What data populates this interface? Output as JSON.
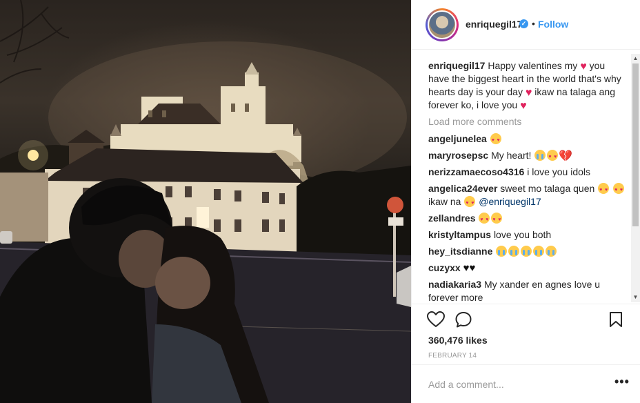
{
  "post": {
    "photo_alt": "Couple embracing at night in front of an illuminated castle",
    "author": {
      "username": "enriquegil17",
      "verified_icon": "verified-badge-icon",
      "separator": "•",
      "follow_label": "Follow"
    },
    "caption": {
      "username": "enriquegil17",
      "part1": "Happy valentines my",
      "part2": "you have the biggest heart in the world that's why hearts day is your day",
      "part3": "ikaw na talaga ang forever ko, i love you"
    },
    "load_more_label": "Load more comments",
    "comments": [
      {
        "user": "angeljunelea",
        "text": "",
        "emoji": [
          "heart-eyes"
        ]
      },
      {
        "user": "maryrosepsc",
        "text": "My heart!",
        "emoji": [
          "cry",
          "heart-eyes",
          "broken-heart"
        ]
      },
      {
        "user": "nerizzamaecoso4316",
        "text": "i love you idols",
        "emoji": []
      },
      {
        "user": "angelica24ever",
        "text": "sweet mo talaga quen",
        "text2": "ikaw na",
        "mention": "@enriquegil17"
      },
      {
        "user": "zellandres",
        "text": "",
        "emoji": [
          "heart-eyes",
          "heart-eyes"
        ]
      },
      {
        "user": "kristyltampus",
        "text": "love you both",
        "emoji": []
      },
      {
        "user": "hey_itsdianne",
        "text": "",
        "emoji": [
          "cry",
          "cry",
          "cry",
          "cry",
          "cry"
        ]
      },
      {
        "user": "cuzyxx",
        "text": "",
        "emoji": [
          "black-heart",
          "black-heart"
        ]
      },
      {
        "user": "nadiakaria3",
        "text": "My xander en agnes love u forever more",
        "emoji": []
      }
    ],
    "likes": "360,476 likes",
    "date": "FEBRUARY 14",
    "add_comment_placeholder": "Add a comment...",
    "more_label": "•••"
  },
  "colors": {
    "link_blue": "#3897f0",
    "heart_red": "#e0245e",
    "muted": "#999999",
    "text": "#262626"
  }
}
